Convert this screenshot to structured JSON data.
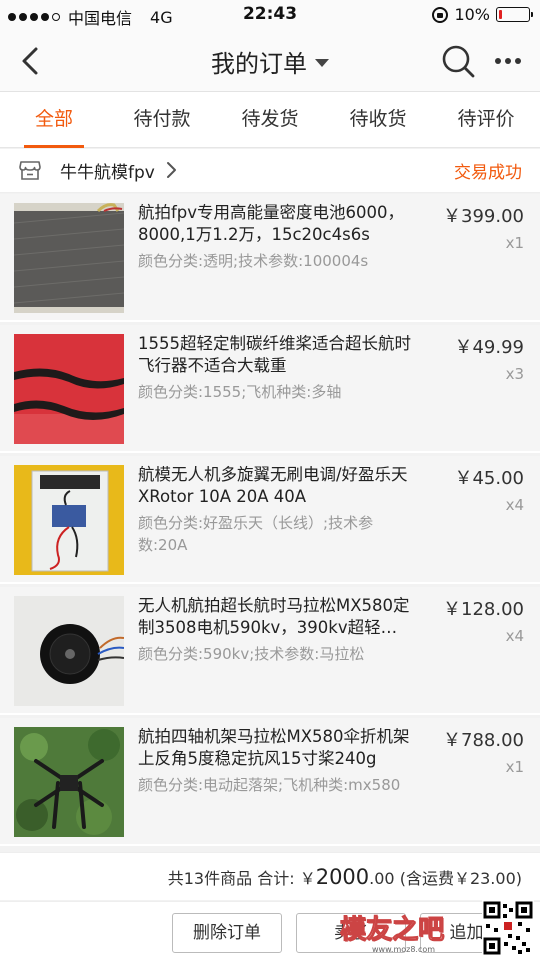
{
  "status_bar": {
    "carrier": "中国电信",
    "network": "4G",
    "time": "22:43",
    "battery_pct": "10%",
    "battery_level": 0.1
  },
  "nav": {
    "title": "我的订单"
  },
  "tabs": [
    {
      "label": "全部",
      "active": true
    },
    {
      "label": "待付款"
    },
    {
      "label": "待发货"
    },
    {
      "label": "待收货"
    },
    {
      "label": "待评价"
    }
  ],
  "shop": {
    "name": "牛牛航模fpv",
    "status": "交易成功"
  },
  "items": [
    {
      "title": "航拍fpv专用高能量密度电池6000，8000,1万1.2万，15c20c4s6s",
      "spec": "颜色分类:透明;技术参数:100004s",
      "price": "￥399.00",
      "qty": "x1"
    },
    {
      "title": "1555超轻定制碳纤维桨适合超长航时飞行器不适合大载重",
      "spec": "颜色分类:1555;飞机种类:多轴",
      "price": "￥49.99",
      "qty": "x3"
    },
    {
      "title": "航模无人机多旋翼无刷电调/好盈乐天 XRotor 10A 20A 40A",
      "spec": "颜色分类:好盈乐天（长线）;技术参数:20A",
      "price": "￥45.00",
      "qty": "x4"
    },
    {
      "title": "无人机航拍超长航时马拉松MX580定制3508电机590kv，390kv超轻…",
      "spec": "颜色分类:590kv;技术参数:马拉松",
      "price": "￥128.00",
      "qty": "x4"
    },
    {
      "title": "航拍四轴机架马拉松MX580伞折机架上反角5度稳定抗风15寸桨240g",
      "spec": "颜色分类:电动起落架;飞机种类:mx580",
      "price": "￥788.00",
      "qty": "x1"
    }
  ],
  "summary": {
    "count_text": "共13件商品 合计:",
    "currency": "￥",
    "total": "2000",
    "cents": ".00",
    "shipping": "(含运费￥23.00)"
  },
  "actions": {
    "delete": "删除订单",
    "sell": "卖了",
    "add": "追加评"
  },
  "watermark": {
    "text": "模友之吧",
    "url": "www.moz8.com"
  }
}
